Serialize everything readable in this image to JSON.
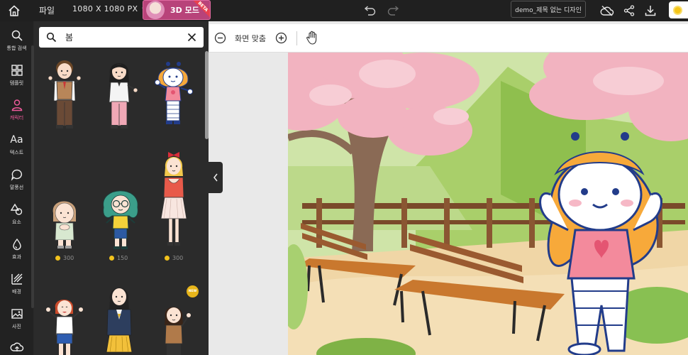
{
  "topbar": {
    "home_icon": "home-icon",
    "file_label": "파일",
    "canvas_size": "1080 X 1080 PX",
    "mode3d_label": "3D 모드",
    "beta_label": "BETA",
    "project_title": "demo_제목 없는 디자인",
    "icons": [
      "undo-icon",
      "redo-icon",
      "cloud-off-icon",
      "share-icon",
      "download-icon",
      "coin-icon"
    ]
  },
  "leftnav": {
    "items": [
      {
        "label": "통합 검색",
        "icon": "search-icon"
      },
      {
        "label": "템플릿",
        "icon": "template-grid-icon"
      },
      {
        "label": "캐릭터",
        "icon": "person-icon",
        "active": true
      },
      {
        "label": "텍스트",
        "icon": "text-aa-icon"
      },
      {
        "label": "말풍선",
        "icon": "speech-bubble-icon"
      },
      {
        "label": "요소",
        "icon": "shapes-icon"
      },
      {
        "label": "효과",
        "icon": "drop-icon"
      },
      {
        "label": "배경",
        "icon": "background-icon"
      },
      {
        "label": "사진",
        "icon": "photo-icon"
      },
      {
        "label": "",
        "icon": "upload-icon"
      }
    ],
    "active_color": "#ef5a9b"
  },
  "panel": {
    "search_value": "봄",
    "prices": [
      "300",
      "150",
      "300"
    ],
    "new_badge": "NEW"
  },
  "workspace": {
    "fit_label": "화면 맞춤"
  }
}
